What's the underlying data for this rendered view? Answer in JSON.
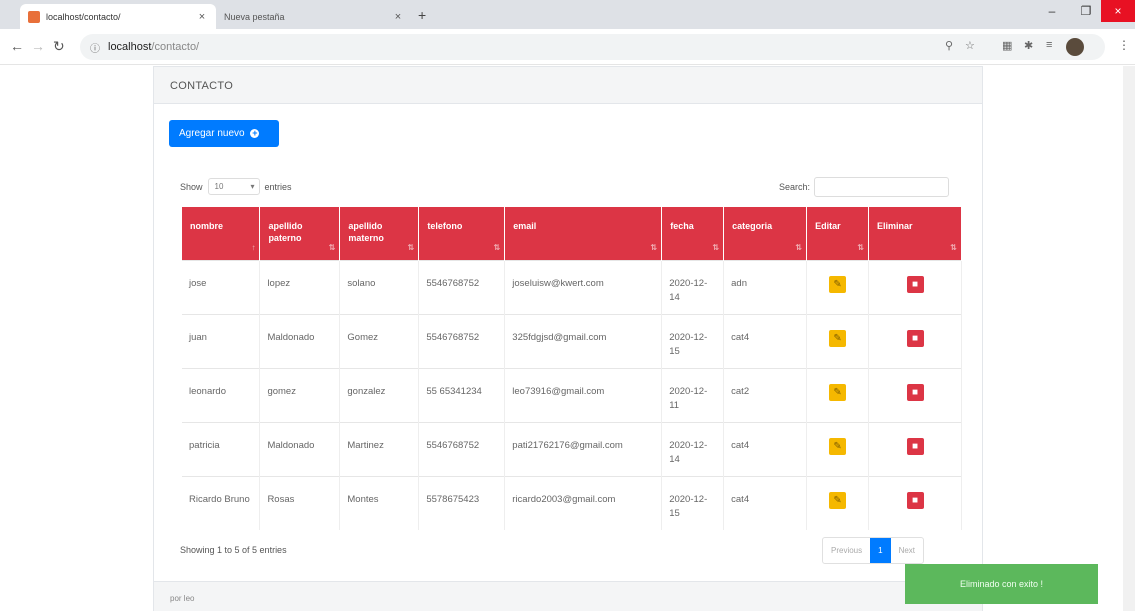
{
  "browser": {
    "tabs": [
      {
        "title": "localhost/contacto/",
        "active": true
      },
      {
        "title": "Nueva pestaña",
        "active": false
      }
    ],
    "new_tab": "+",
    "url_host": "localhost",
    "url_path": "/contacto/",
    "window_controls": {
      "minimize": "–",
      "maximize": "❐",
      "close": "×"
    }
  },
  "card": {
    "header": "CONTACTO",
    "add_button": "Agregar nuevo",
    "length": {
      "show": "Show",
      "value": "10",
      "entries": "entries"
    },
    "search_label": "Search:",
    "columns": [
      "nombre",
      "apellido paterno",
      "apellido materno",
      "telefono",
      "email",
      "fecha",
      "categoria",
      "Editar",
      "Eliminar"
    ],
    "rows": [
      {
        "nombre": "jose",
        "paterno": "lopez",
        "materno": "solano",
        "telefono": "5546768752",
        "email": "joseluisw@kwert.com",
        "fecha": "2020-12-14",
        "categoria": "adn"
      },
      {
        "nombre": "juan",
        "paterno": "Maldonado",
        "materno": "Gomez",
        "telefono": "5546768752",
        "email": "325fdgjsd@gmail.com",
        "fecha": "2020-12-15",
        "categoria": "cat4"
      },
      {
        "nombre": "leonardo",
        "paterno": "gomez",
        "materno": "gonzalez",
        "telefono": "55 65341234",
        "email": "leo73916@gmail.com",
        "fecha": "2020-12-11",
        "categoria": "cat2"
      },
      {
        "nombre": "patricia",
        "paterno": "Maldonado",
        "materno": "Martinez",
        "telefono": "5546768752",
        "email": "pati21762176@gmail.com",
        "fecha": "2020-12-14",
        "categoria": "cat4"
      },
      {
        "nombre": "Ricardo Bruno",
        "paterno": "Rosas",
        "materno": "Montes",
        "telefono": "5578675423",
        "email": "ricardo2003@gmail.com",
        "fecha": "2020-12-15",
        "categoria": "cat4"
      }
    ],
    "info": "Showing 1 to 5 of 5 entries",
    "pagination": {
      "previous": "Previous",
      "current": "1",
      "next": "Next"
    },
    "footer": "por leo"
  },
  "toast": "Eliminado con exito !",
  "colors": {
    "primary": "#007bff",
    "danger": "#dc3545",
    "warning": "#f5b800",
    "success": "#5cb85c"
  }
}
